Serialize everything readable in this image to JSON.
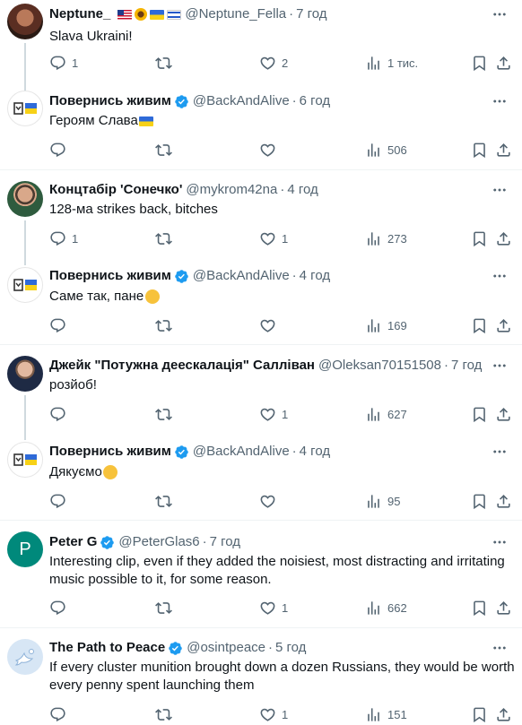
{
  "tweets": [
    {
      "name": "Neptune_",
      "handle": "@Neptune_Fella",
      "time": "7 год",
      "text": "Slava Ukraini!",
      "replies": "1",
      "retweets": "",
      "likes": "2",
      "views": "1 тис."
    },
    {
      "name": "Повернись живим",
      "handle": "@BackAndAlive",
      "time": "6 год",
      "text": "Героям Слава",
      "replies": "",
      "retweets": "",
      "likes": "",
      "views": "506"
    },
    {
      "name": "Концтабір 'Сонечко'",
      "handle": "@mykrom42na",
      "time": "4 год",
      "text": "128-ма strikes back, bitches",
      "replies": "1",
      "retweets": "",
      "likes": "1",
      "views": "273"
    },
    {
      "name": "Повернись живим",
      "handle": "@BackAndAlive",
      "time": "4 год",
      "text": "Саме так, пане",
      "replies": "",
      "retweets": "",
      "likes": "",
      "views": "169"
    },
    {
      "name": "Джейк \"Потужна деескалація\" Салліван",
      "handle": "@Oleksan70151508",
      "time": "7 год",
      "text": "розйоб!",
      "replies": "",
      "retweets": "",
      "likes": "1",
      "views": "627"
    },
    {
      "name": "Повернись живим",
      "handle": "@BackAndAlive",
      "time": "4 год",
      "text": "Дякуємо",
      "replies": "",
      "retweets": "",
      "likes": "",
      "views": "95"
    },
    {
      "name": "Peter G",
      "handle": "@PeterGlas6",
      "time": "7 год",
      "text": "Interesting clip, even if they added the noisiest, most distracting and irritating music possible to it, for some reason.",
      "replies": "",
      "retweets": "",
      "likes": "1",
      "views": "662",
      "avatar_letter": "P"
    },
    {
      "name": "The Path to Peace",
      "handle": "@osintpeace",
      "time": "5 год",
      "text": "If every cluster munition brought down a dozen Russians, they would be worth every penny spent launching them",
      "replies": "",
      "retweets": "",
      "likes": "1",
      "views": "151"
    }
  ],
  "colors": {
    "text": "#0f1419",
    "secondary": "#536471",
    "verified": "#1d9bf0",
    "peter_avatar": "#00897b"
  }
}
